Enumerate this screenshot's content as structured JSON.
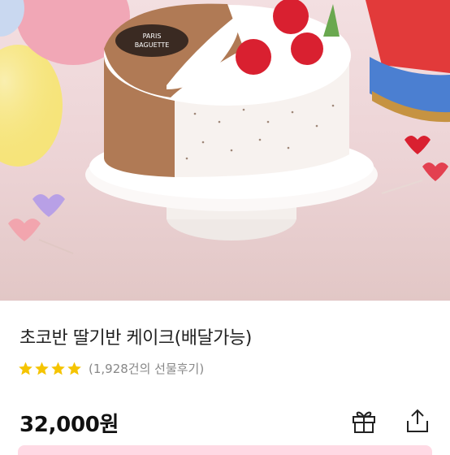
{
  "product": {
    "brand_on_cake": [
      "PARIS",
      "BAGUETTE"
    ],
    "title": "초코반 딸기반 케이크(배달가능)",
    "rating_stars": 4,
    "review_count_text": "(1,928건의 선물후기)",
    "price": "32,000원"
  },
  "actions": {
    "gift_icon": "gift-icon",
    "share_icon": "share-icon"
  },
  "colors": {
    "star": "#f5c400",
    "cake_chocolate": "#b07a55",
    "background_pink": "#ecd3d5",
    "bar_pink": "#ffd9e4"
  }
}
